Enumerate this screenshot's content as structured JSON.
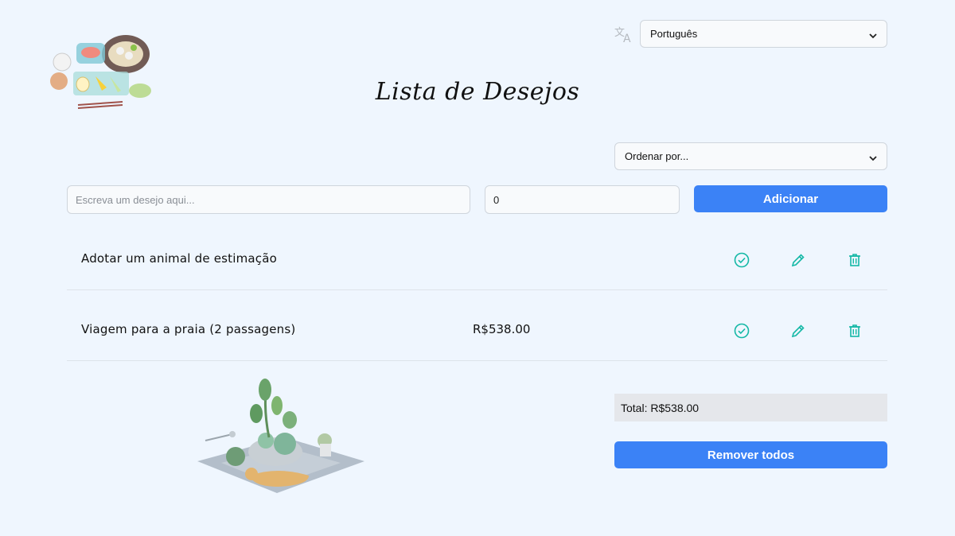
{
  "language": {
    "selected": "Português",
    "icon": "translate-icon"
  },
  "header": {
    "title": "Lista de Desejos"
  },
  "sort": {
    "selected": "Ordenar por..."
  },
  "form": {
    "wish_placeholder": "Escreva um desejo aqui...",
    "price_value": "0",
    "add_label": "Adicionar"
  },
  "wishes": [
    {
      "name": "Adotar um animal de estimação",
      "price": ""
    },
    {
      "name": "Viagem para a praia (2 passagens)",
      "price": "R$538.00"
    }
  ],
  "summary": {
    "total_label": "Total:",
    "total_value": "R$538.00",
    "remove_all_label": "Remover todos"
  },
  "colors": {
    "background": "#eff6fe",
    "primary": "#3b82f6",
    "action_icons": "#14b8a6",
    "total_bg": "#e5e7eb"
  },
  "icons": [
    "check-circle-icon",
    "pencil-icon",
    "trash-icon",
    "chevron-down-icon"
  ]
}
